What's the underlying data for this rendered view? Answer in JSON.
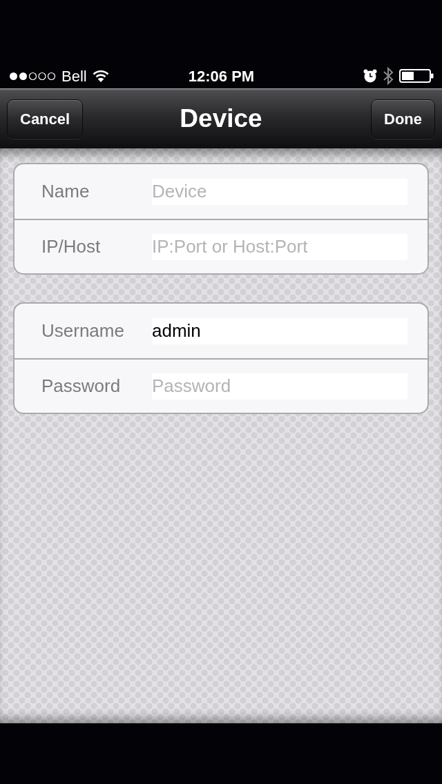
{
  "status_bar": {
    "carrier": "Bell",
    "time": "12:06 PM"
  },
  "nav_bar": {
    "left_button": "Cancel",
    "title": "Device",
    "right_button": "Done"
  },
  "groups": [
    {
      "rows": [
        {
          "label": "Name",
          "placeholder": "Device"
        },
        {
          "label": "IP/Host",
          "placeholder": "IP:Port or Host:Port"
        }
      ]
    },
    {
      "rows": [
        {
          "label": "Username",
          "value": "admin"
        },
        {
          "label": "Password",
          "placeholder": "Password"
        }
      ]
    }
  ]
}
